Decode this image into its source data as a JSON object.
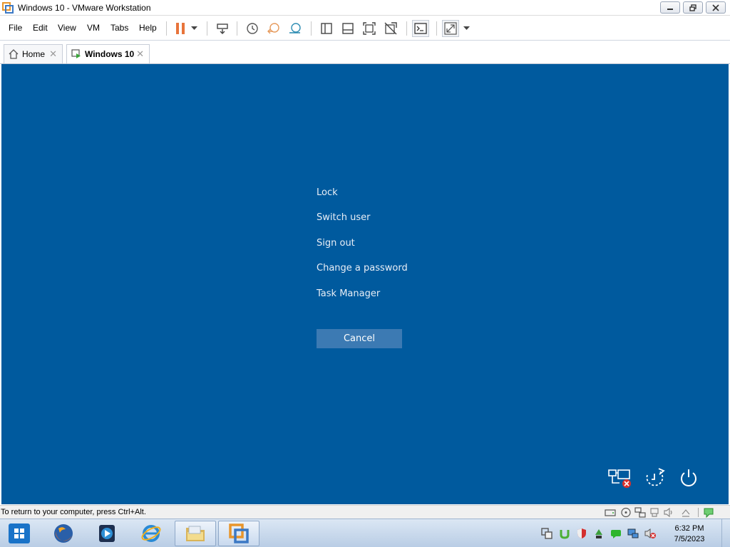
{
  "window": {
    "title": "Windows 10 - VMware Workstation"
  },
  "menu": {
    "items": [
      "File",
      "Edit",
      "View",
      "VM",
      "Tabs",
      "Help"
    ]
  },
  "tabs": [
    {
      "label": "Home"
    },
    {
      "label": "Windows 10"
    }
  ],
  "vm_screen": {
    "options": [
      "Lock",
      "Switch user",
      "Sign out",
      "Change a password",
      "Task Manager"
    ],
    "cancel_label": "Cancel",
    "background_color": "#005a9e"
  },
  "statusbar": {
    "message": "To return to your computer, press Ctrl+Alt."
  },
  "taskbar": {
    "clock_time": "6:32 PM",
    "clock_date": "7/5/2023"
  },
  "colors": {
    "pause_orange": "#e8743b",
    "accent_blue": "#1a73c8"
  }
}
